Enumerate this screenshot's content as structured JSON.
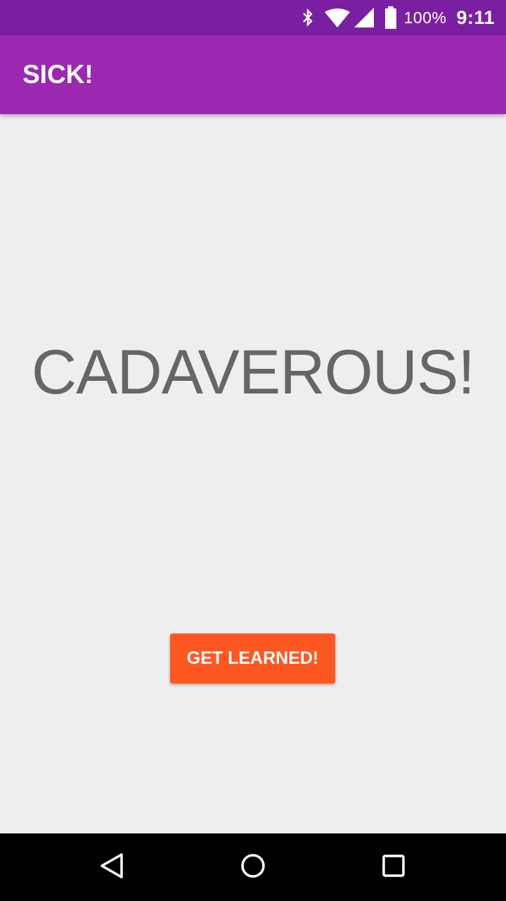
{
  "status_bar": {
    "icons": [
      "bluetooth-icon",
      "wifi-icon",
      "cell-signal-icon",
      "battery-icon"
    ],
    "battery_text": "100%",
    "time": "9:11",
    "background": "#7B1FA2"
  },
  "app_bar": {
    "title": "SICK!",
    "background": "#9C27B0"
  },
  "main": {
    "word": "CADAVEROUS!",
    "button_label": "GET LEARNED!",
    "button_color": "#FF5722",
    "background": "#EEEEEE"
  },
  "nav_bar": {
    "buttons": [
      "back-icon",
      "home-icon",
      "recents-icon"
    ]
  }
}
